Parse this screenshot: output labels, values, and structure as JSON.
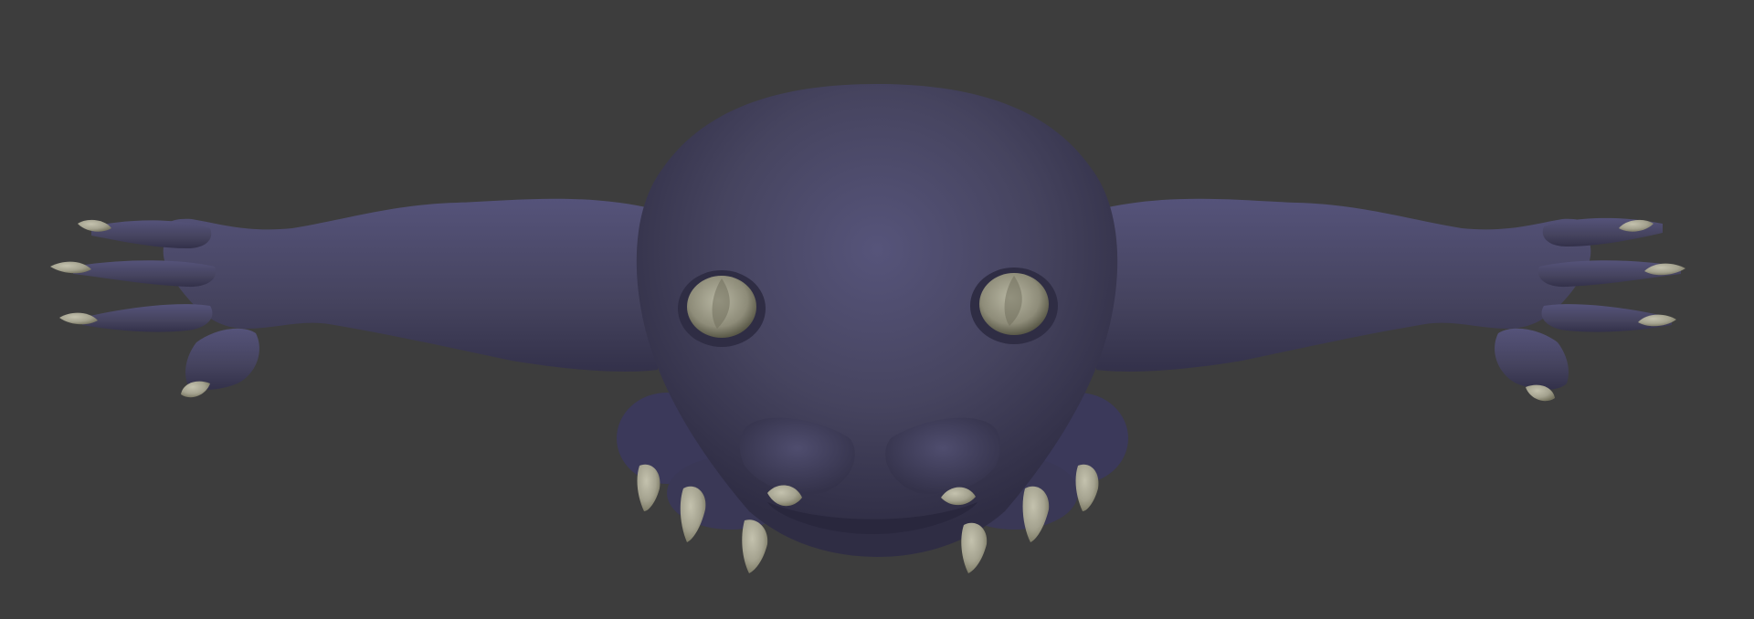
{
  "viewport": {
    "background": "#3d3d3d",
    "model": "creature-sculpt",
    "material": {
      "body_color": "#4a4866",
      "claw_color": "#a7a593"
    }
  }
}
